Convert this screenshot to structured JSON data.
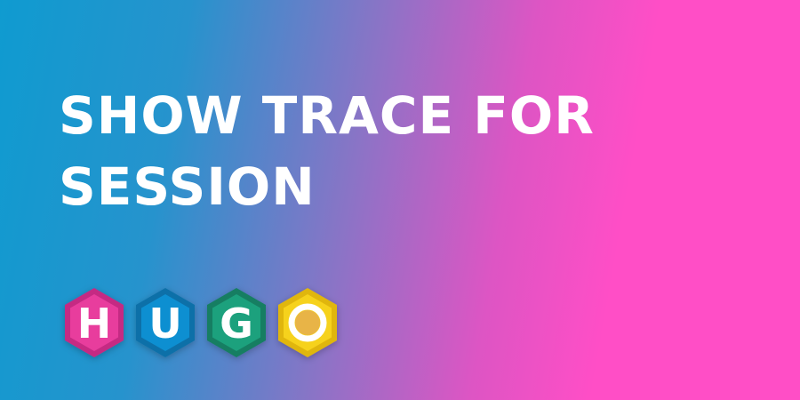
{
  "title": {
    "line1": "SHOW TRACE FOR",
    "line2": "SESSION"
  },
  "logo": {
    "letters": [
      "H",
      "U",
      "G",
      "O"
    ],
    "colors": {
      "h": "#e83d9d",
      "u": "#0f8fd1",
      "g": "#1fa17d",
      "o": "#f6d21a"
    }
  }
}
